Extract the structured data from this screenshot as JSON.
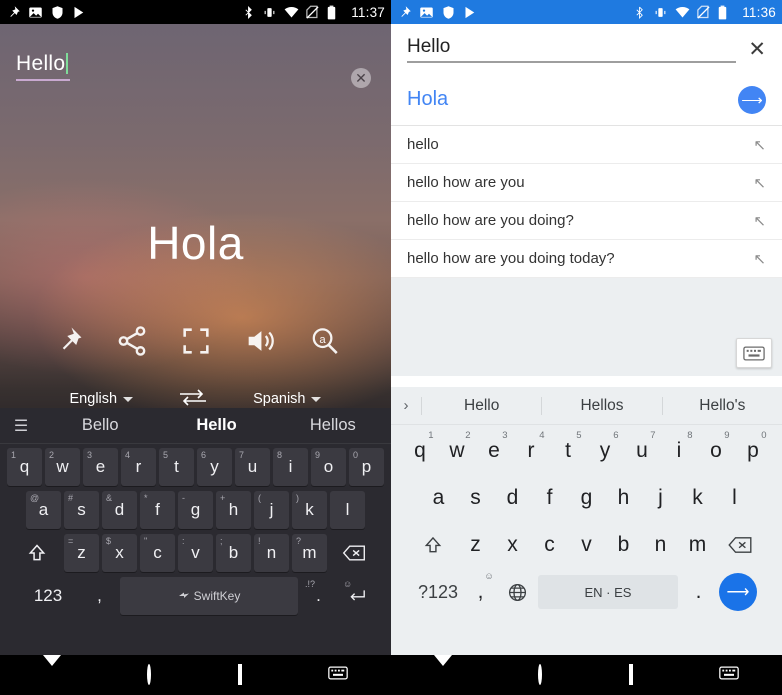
{
  "left": {
    "status_bar": {
      "clock": "11:37",
      "icons": [
        "pin-icon",
        "photos-icon",
        "shield-icon",
        "play-icon",
        "bluetooth-icon",
        "vibrate-icon",
        "wifi-icon",
        "no-sim-icon",
        "battery-icon"
      ]
    },
    "input": {
      "value": "Hello",
      "clear_label": "✕"
    },
    "translation": "Hola",
    "actions": [
      "pin-icon",
      "share-icon",
      "fullscreen-icon",
      "speaker-icon",
      "copy-a-icon"
    ],
    "source_lang": "English",
    "swap_label": "swap-languages-icon",
    "target_lang": "Spanish",
    "keyboard": {
      "menu_icon": "hamburger-icon",
      "suggestions": [
        "Bello",
        "Hello",
        "Hellos"
      ],
      "active_suggestion": "Hello",
      "row1": [
        {
          "sup": "1",
          "k": "q"
        },
        {
          "sup": "2",
          "k": "w"
        },
        {
          "sup": "3",
          "k": "e"
        },
        {
          "sup": "4",
          "k": "r"
        },
        {
          "sup": "5",
          "k": "t"
        },
        {
          "sup": "6",
          "k": "y"
        },
        {
          "sup": "7",
          "k": "u"
        },
        {
          "sup": "8",
          "k": "i"
        },
        {
          "sup": "9",
          "k": "o"
        },
        {
          "sup": "0",
          "k": "p"
        }
      ],
      "row2": [
        {
          "sup": "@",
          "k": "a"
        },
        {
          "sup": "#",
          "k": "s"
        },
        {
          "sup": "&",
          "k": "d"
        },
        {
          "sup": "*",
          "k": "f"
        },
        {
          "sup": "-",
          "k": "g"
        },
        {
          "sup": "+",
          "k": "h"
        },
        {
          "sup": "(",
          "k": "j"
        },
        {
          "sup": ")",
          "k": "k"
        },
        {
          "sup": "",
          "k": "l"
        }
      ],
      "row3_shift": "shift-icon",
      "row3": [
        {
          "sup": "=",
          "k": "z"
        },
        {
          "sup": "$",
          "k": "x"
        },
        {
          "sup": "\"",
          "k": "c"
        },
        {
          "sup": ":",
          "k": "v"
        },
        {
          "sup": ";",
          "k": "b"
        },
        {
          "sup": "!",
          "k": "n"
        },
        {
          "sup": "?",
          "k": "m"
        }
      ],
      "row3_backspace": "backspace-icon",
      "row4_num": "123",
      "row4_comma": ",",
      "row4_space": "SwiftKey",
      "row4_period_sup": ".!?",
      "row4_period": ".",
      "row4_enter": "enter-icon",
      "row4_emoji": "emoji-icon"
    },
    "navbar": [
      "back-icon",
      "home-icon",
      "recents-icon",
      "keyboard-icon"
    ]
  },
  "right": {
    "status_bar": {
      "clock": "11:36",
      "icons": [
        "pin-icon",
        "photos-icon",
        "shield-icon",
        "play-icon",
        "bluetooth-icon",
        "vibrate-icon",
        "wifi-icon",
        "no-sim-icon",
        "battery-icon"
      ]
    },
    "search": {
      "value": "Hello",
      "close_label": "✕"
    },
    "result": {
      "text": "Hola",
      "go_icon": "arrow-right-icon"
    },
    "suggestions": [
      "hello",
      "hello how are you",
      "hello how are you doing?",
      "hello how are you doing today?"
    ],
    "suggestion_arrow": "arrow-up-left-icon",
    "keyboard_toggle_icon": "keyboard-icon",
    "keyboard": {
      "chevron": "›",
      "suggestions": [
        "Hello",
        "Hellos",
        "Hello's"
      ],
      "row1": [
        {
          "sup": "1",
          "k": "q"
        },
        {
          "sup": "2",
          "k": "w"
        },
        {
          "sup": "3",
          "k": "e"
        },
        {
          "sup": "4",
          "k": "r"
        },
        {
          "sup": "5",
          "k": "t"
        },
        {
          "sup": "6",
          "k": "y"
        },
        {
          "sup": "7",
          "k": "u"
        },
        {
          "sup": "8",
          "k": "i"
        },
        {
          "sup": "9",
          "k": "o"
        },
        {
          "sup": "0",
          "k": "p"
        }
      ],
      "row2": [
        "a",
        "s",
        "d",
        "f",
        "g",
        "h",
        "j",
        "k",
        "l"
      ],
      "row3_shift": "shift-icon",
      "row3": [
        "z",
        "x",
        "c",
        "v",
        "b",
        "n",
        "m"
      ],
      "row3_backspace": "backspace-icon",
      "row4_sym": "?123",
      "row4_emoji_sup": "☺",
      "row4_emoji": ",",
      "row4_globe": "globe-icon",
      "row4_space": "EN · ES",
      "row4_period": ".",
      "row4_send": "send-arrow-icon"
    },
    "navbar": [
      "back-icon",
      "home-icon",
      "recents-icon",
      "keyboard-icon"
    ]
  }
}
